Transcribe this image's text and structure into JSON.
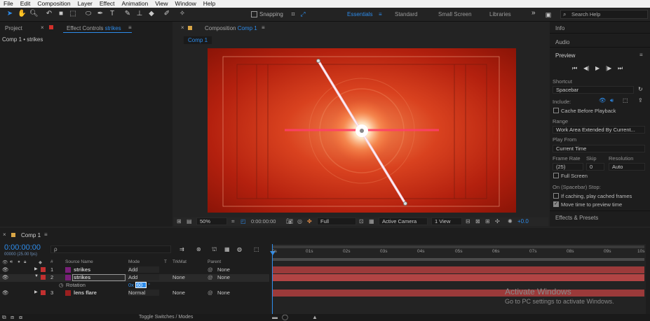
{
  "menu": [
    "File",
    "Edit",
    "Composition",
    "Layer",
    "Effect",
    "Animation",
    "View",
    "Window",
    "Help"
  ],
  "toolbar": {
    "snapping_label": "Snapping",
    "workspaces": [
      "Essentials",
      "Standard",
      "Small Screen",
      "Libraries"
    ],
    "active_workspace": "Essentials",
    "more": "»",
    "search_placeholder": "Search Help"
  },
  "left_panel": {
    "tab_project": "Project",
    "tab_effect_controls_prefix": "Effect Controls",
    "tab_effect_controls_layer": "strikes",
    "breadcrumb": "Comp 1 • strikes"
  },
  "composition_panel": {
    "tab_prefix": "Composition",
    "tab_comp": "Comp 1",
    "subtab": "Comp 1",
    "zoom": "50%",
    "timecode": "0:00:00:00",
    "resolution": "Full",
    "camera": "Active Camera",
    "views": "1 View",
    "exposure": "+0.0"
  },
  "right_panel": {
    "tab_info": "Info",
    "tab_audio": "Audio",
    "tab_preview": "Preview",
    "shortcut_label": "Shortcut",
    "shortcut_value": "Spacebar",
    "include_label": "Include:",
    "cache_before_playback": "Cache Before Playback",
    "range_label": "Range",
    "range_value": "Work Area Extended By Current...",
    "play_from_label": "Play From",
    "play_from_value": "Current Time",
    "frame_rate_label": "Frame Rate",
    "skip_label": "Skip",
    "resolution_label": "Resolution",
    "frame_rate_value": "(25)",
    "skip_value": "0",
    "resolution_value": "Auto",
    "full_screen": "Full Screen",
    "on_stop_label": "On (Spacebar) Stop:",
    "if_caching": "If caching, play cached frames",
    "move_time": "Move time to preview time",
    "effects_presets": "Effects & Presets"
  },
  "timeline": {
    "tab": "Comp 1",
    "timecode": "0:00:00:00",
    "timecode_sub": "00000 (25.00 fps)",
    "search_placeholder": "ρ",
    "columns": {
      "hash": "#",
      "source_name": "Source Name",
      "mode": "Mode",
      "t": "T",
      "trkmat": "TrkMat",
      "parent": "Parent"
    },
    "layers": [
      {
        "num": "1",
        "name": "strikes",
        "mode": "Add",
        "trkmat": "",
        "parent": "None",
        "color": "#7a1f7a"
      },
      {
        "num": "2",
        "name": "strikes",
        "mode": "Add",
        "trkmat": "None",
        "parent": "None",
        "color": "#7a1f7a"
      },
      {
        "num": "3",
        "name": "lens flare",
        "mode": "Normal",
        "trkmat": "None",
        "parent": "None",
        "color": "#9a1f1f"
      }
    ],
    "rotation_label": "Rotation",
    "rotation_prefix": "0x",
    "rotation_value": "60",
    "rotation_suffix": "°",
    "ruler": [
      "0s",
      "01s",
      "02s",
      "03s",
      "04s",
      "05s",
      "06s",
      "07s",
      "08s",
      "09s",
      "10s"
    ],
    "toggle_label": "Toggle Switches / Modes"
  },
  "watermark": {
    "title": "Activate Windows",
    "subtitle": "Go to PC settings to activate Windows."
  }
}
